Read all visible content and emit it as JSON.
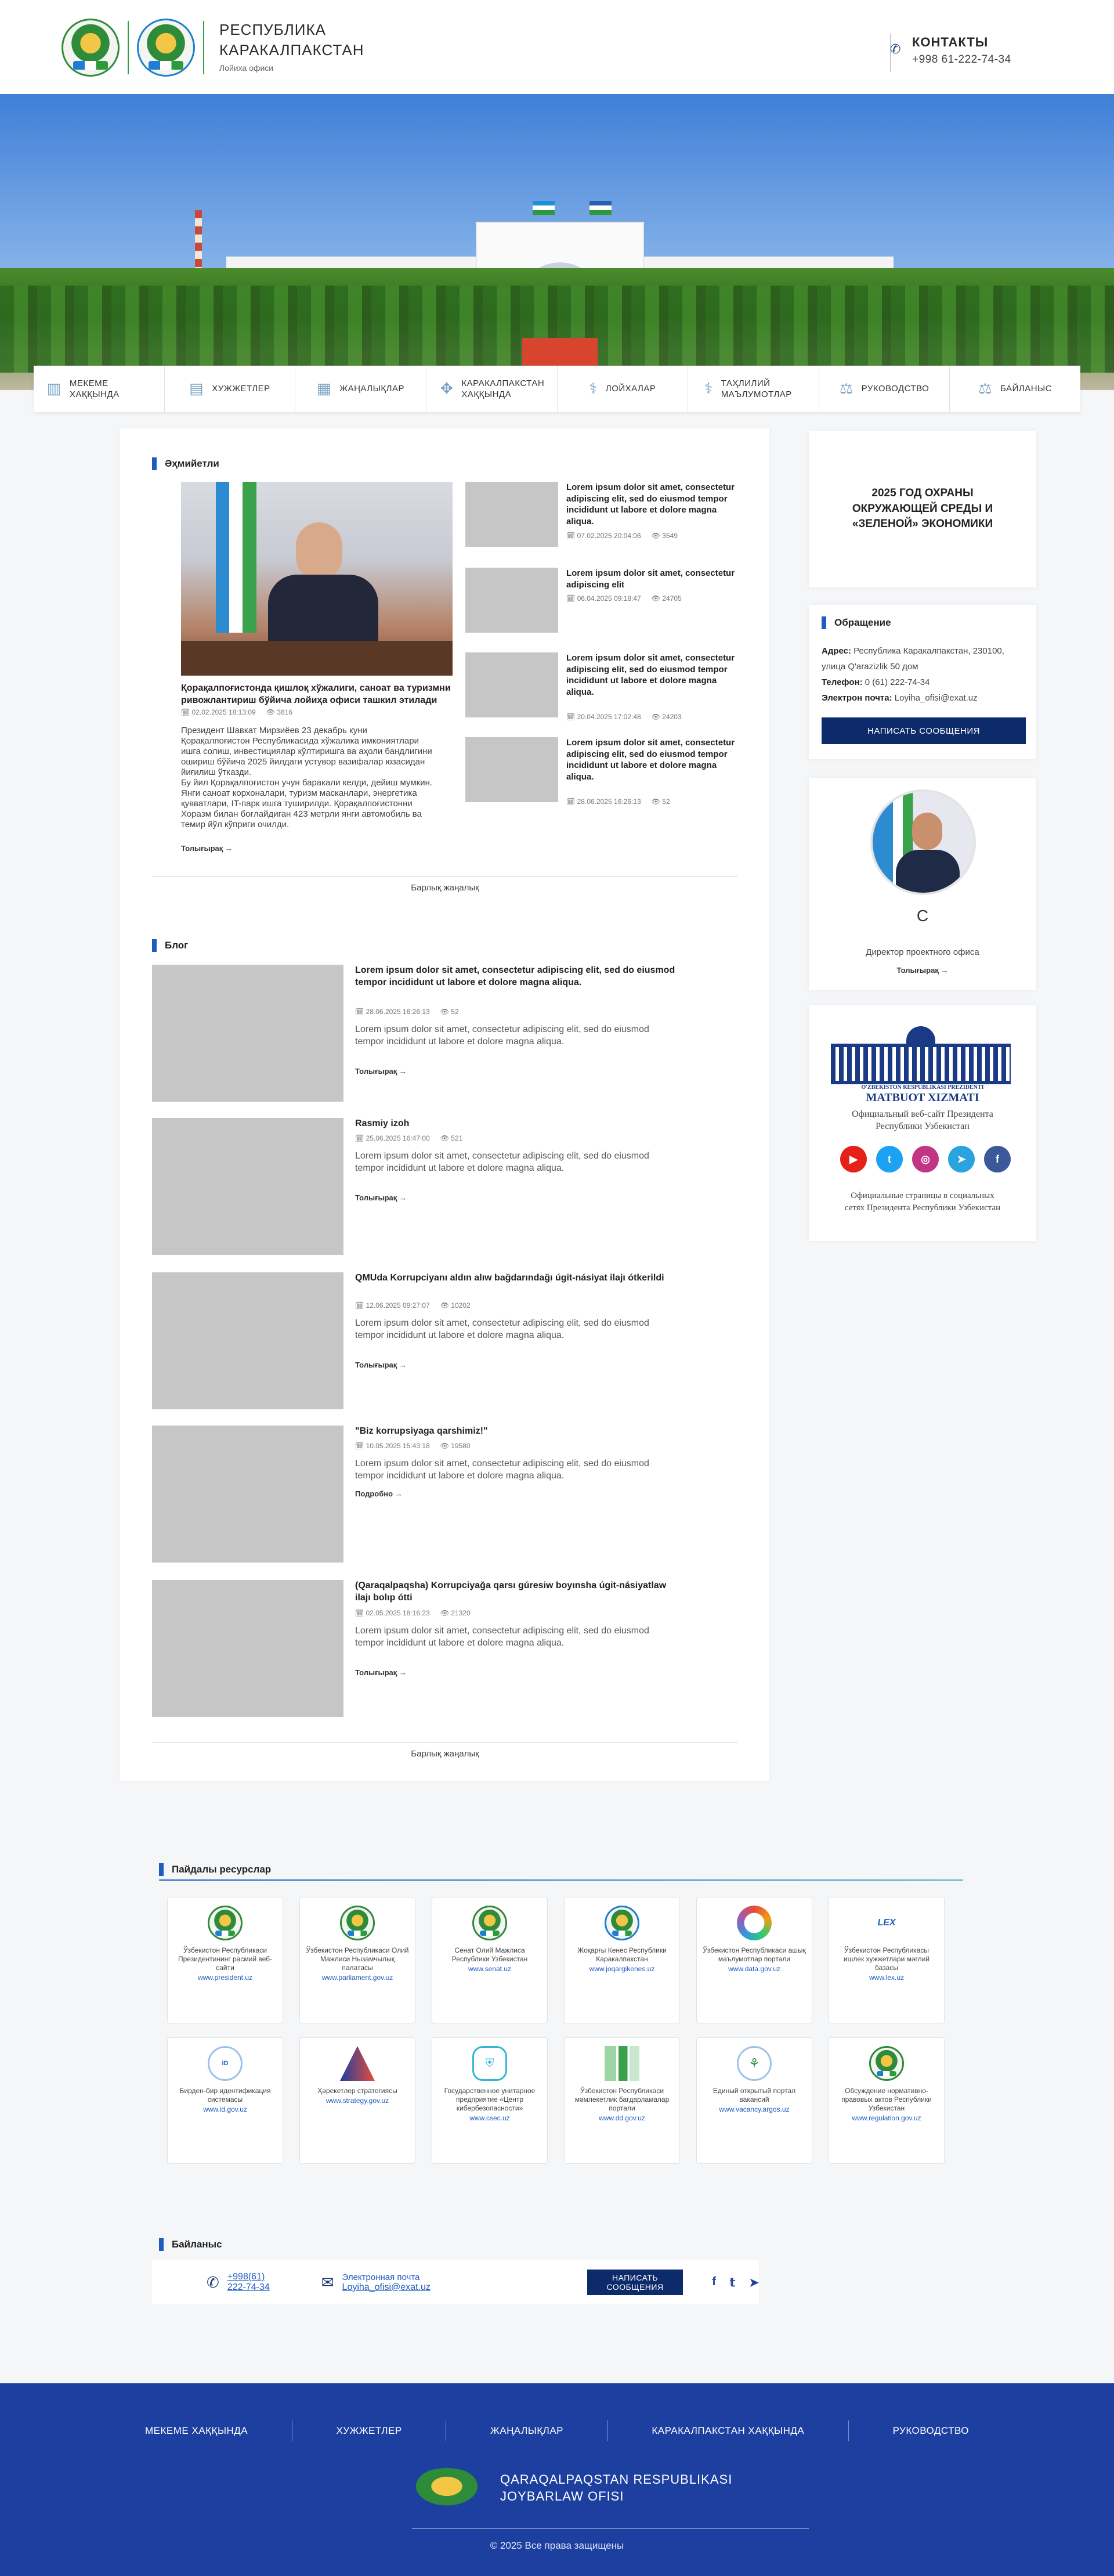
{
  "header": {
    "title_line1": "РЕСПУБЛИКА",
    "title_line2": "КАРАКАЛПАКСТАН",
    "subtitle": "Лойиха офиси",
    "contacts_label": "КОНТАКТЫ",
    "phone": "+998 61-222-74-34"
  },
  "nav": {
    "items": [
      {
        "label": "МЕКЕМЕ ХАҚҚЫНДА",
        "icon": "building-icon"
      },
      {
        "label": "ХУЖЖЕТЛЕР",
        "icon": "document-icon"
      },
      {
        "label": "ЖАҢАЛЫҚЛАР",
        "icon": "newspaper-icon"
      },
      {
        "label": "КАРАКАЛПАКСТАН ХАҚҚЫНДА",
        "icon": "map-icon"
      },
      {
        "label": "ЛОЙХАЛАР",
        "icon": "caduceus-icon"
      },
      {
        "label": "ТАҲЛИЛИЙ МАЪЛУМОТЛАР",
        "icon": "caduceus-icon"
      },
      {
        "label": "РУКОВОДСТВО",
        "icon": "scales-icon"
      },
      {
        "label": "БАЙЛАНЫС",
        "icon": "scales-icon"
      }
    ]
  },
  "news": {
    "heading": "Әҳмийетли",
    "lead": {
      "title": "Қорақалпоғистонда қишлоқ хўжалиги, саноат ва туризмни ривожлантириш бўйича лойиҳа офиси ташкил этилади",
      "date": "02.02.2025 18:13:09",
      "views": "3816",
      "text": "Президент Шавкат Мирзиёев 23 декабрь куни\nҚорақалпоғистон Республикасида хўжалика имкониятлари\nишга солиш, инвестициялар кўлтиришга ва аҳоли бандлигини\nошириш бўйича 2025 йилдаги устувор вазифалар юзасидан\nйиғилиш ўтказди.\nБу йил Қорақалпоғистон учун баракали келди, дейиш мумкин.\nЯнги саноат корхоналари, туризм масканлари, энергетика\nқувватлари, IT-парк ишга туширилди. Қорақалпоғистонни\nХоразм билан боғлайдиган 423 метрли янги автомобиль ва\nтемир йўл кўприги очилди.",
      "more": "Толығырақ →"
    },
    "items": [
      {
        "title": "Lorem ipsum dolor sit amet, consectetur adipiscing elit, sed do eiusmod tempor incididunt ut labore et dolore magna aliqua.",
        "date": "07.02.2025 20:04:06",
        "views": "3549"
      },
      {
        "title": "Lorem ipsum dolor sit amet, consectetur adipiscing elit",
        "date": "06.04.2025 09:18:47",
        "views": "24705"
      },
      {
        "title": "Lorem ipsum dolor sit amet, consectetur adipiscing elit, sed do eiusmod tempor incididunt ut labore et dolore magna aliqua.",
        "date": "20.04.2025 17:02:48",
        "views": "24203"
      },
      {
        "title": "Lorem ipsum dolor sit amet, consectetur adipiscing elit, sed do eiusmod tempor incididunt ut labore et dolore magna aliqua.",
        "date": "28.06.2025 16:26:13",
        "views": "52"
      }
    ],
    "all_link": "Барлық жаңалық"
  },
  "blog": {
    "heading": "Блог",
    "items": [
      {
        "title": "Lorem ipsum dolor sit amet, consectetur adipiscing elit, sed do eiusmod tempor incididunt ut labore et dolore magna aliqua.",
        "date": "28.06.2025 16:26:13",
        "views": "52",
        "text": "Lorem ipsum dolor sit amet, consectetur adipiscing elit, sed do eiusmod tempor incididunt ut labore et dolore magna aliqua.",
        "more": "Толығырақ →"
      },
      {
        "title": "Rasmiy izoh",
        "date": "25.06.2025 16:47:00",
        "views": "521",
        "text": "Lorem ipsum dolor sit amet, consectetur adipiscing elit, sed do eiusmod tempor incididunt ut labore et dolore magna aliqua.",
        "more": "Толығырақ →"
      },
      {
        "title": "QMUda Korrupciyanı aldın alıw bağdarındağı úgit-násiyat ilajı ótkerildi",
        "date": "12.06.2025 09:27:07",
        "views": "10202",
        "text": "Lorem ipsum dolor sit amet, consectetur adipiscing elit, sed do eiusmod tempor incididunt ut labore et dolore magna aliqua.",
        "more": "Толығырақ →"
      },
      {
        "title": "\"Biz korrupsiyaga qarshimiz!\"",
        "date": "10.05.2025 15:43:18",
        "views": "19580",
        "text": "Lorem ipsum dolor sit amet, consectetur adipiscing elit, sed do eiusmod tempor incididunt ut labore et dolore magna aliqua.",
        "more": "Подробно →"
      },
      {
        "title": "(Qaraqalpaqsha) Korrupciyağa qarsı gúresiw boyınsha úgit-násiyatlaw ilajı bolıp ótti",
        "date": "02.05.2025 18:16:23",
        "views": "21320",
        "text": "Lorem ipsum dolor sit amet, consectetur adipiscing elit, sed do eiusmod tempor incididunt ut labore et dolore magna aliqua.",
        "more": "Толығырақ →"
      }
    ],
    "all_link": "Барлық жаңалық"
  },
  "sidebar": {
    "eco_banner": "2025 ГОД ОХРАНЫ ОКРУЖАЮЩЕЙ СРЕДЫ И «ЗЕЛЕНОЙ» ЭКОНОМИКИ",
    "appeal": {
      "heading": "Обращение",
      "address_label": "Адрес:",
      "address": "Республика Каракалпакстан, 230100, улица Q'arazizlik 50 дом",
      "phone_label": "Телефон:",
      "phone": "0 (61) 222-74-34",
      "email_label": "Электрон почта:",
      "email": "Loyiha_ofisi@exat.uz",
      "button": "НАПИСАТЬ СООБЩЕНИЯ"
    },
    "director": {
      "name": "С",
      "role": "Директор проектного офиса",
      "more": "Толығырақ →"
    },
    "press": {
      "caption_small": "O'ZBEKISTON RESPUBLIKASI PREZIDENTI",
      "caption_big": "MATBUOT XIZMATI",
      "site_text": "Официальный веб-сайт Президента Республики Узбекистан",
      "social_text": "Официальные страницы в социальных сетях Президента Республики Узбекистан",
      "social": [
        {
          "icon": "youtube-icon",
          "glyph": "▶",
          "color": "#e62117"
        },
        {
          "icon": "twitter-icon",
          "glyph": "t",
          "color": "#1da1f2"
        },
        {
          "icon": "instagram-icon",
          "glyph": "◎",
          "color": "#c13584"
        },
        {
          "icon": "telegram-icon",
          "glyph": "➤",
          "color": "#2aa3de"
        },
        {
          "icon": "facebook-icon",
          "glyph": "f",
          "color": "#3b5998"
        }
      ]
    }
  },
  "resources": {
    "heading": "Пайдалы ресурслар",
    "items": [
      {
        "name": "Ўзбекистон Республикаси Президентининг расмий веб-сайти",
        "url": "www.president.uz",
        "logo": "gerb"
      },
      {
        "name": "Ўзбекистон Республикаси Олий Мажлиси Нызамчылық палатасы",
        "url": "www.parliament.gov.uz",
        "logo": "gerb"
      },
      {
        "name": "Сенат Олий Мажлиса Республики Узбекистан",
        "url": "www.senat.uz",
        "logo": "gerb"
      },
      {
        "name": "Жоқарғы Кенес Республики Каракалпакстан",
        "url": "www.joqargikenes.uz",
        "logo": "gerb"
      },
      {
        "name": "Ўзбекистон Республикаси ашық маълумотлар портали",
        "url": "www.data.gov.uz",
        "logo": "ring"
      },
      {
        "name": "Ўзбекистон Республикасы ишлек хужжетлари мәглий базасы",
        "url": "www.lex.uz",
        "logo": "lex"
      },
      {
        "name": "Бирден-бир идентификация системасы",
        "url": "www.id.gov.uz",
        "logo": "oneid"
      },
      {
        "name": "Ҳәрекетлер стратегиясы",
        "url": "www.strategy.gov.uz",
        "logo": "strategy"
      },
      {
        "name": "Государственное унитарное предприятие «Центр кибербезопасности»",
        "url": "www.csec.uz",
        "logo": "cyber"
      },
      {
        "name": "Ўзбекистон Республикаси мәмлекетлик бағдарламалар портали",
        "url": "www.dd.gov.uz",
        "logo": "blocks"
      },
      {
        "name": "Единый открытый портал вакансий",
        "url": "www.vacancy.argos.uz",
        "logo": "vacancy"
      },
      {
        "name": "Обсуждение нормативно-правовых актов Республики Узбекистан",
        "url": "www.regulation.gov.uz",
        "logo": "gerb"
      }
    ]
  },
  "contacts": {
    "heading": "Байланыс",
    "phone": "+998(61) 222-74-34",
    "email_label": "Электронная почта",
    "email": "Loyiha_ofisi@exat.uz",
    "button": "НАПИСАТЬ СООБЩЕНИЯ"
  },
  "footer": {
    "nav": [
      "МЕКЕМЕ ХАҚҚЫНДА",
      "ХУЖЖЕТЛЕР",
      "ЖАҢАЛЫҚЛАР",
      "КАРАКАЛПАКСТАН ХАҚҚЫНДА",
      "РУКОВОДСТВО"
    ],
    "brand_line1": "QARAQALPAQSTAN RESPUBLIKASI",
    "brand_line2": "JOYBARLAW OFISI",
    "copyright": "© 2025 Все права защищены"
  },
  "colors": {
    "accent": "#1f5cc0",
    "button_dark": "#0d2a6a",
    "footer_bg": "#1d3fa0"
  }
}
